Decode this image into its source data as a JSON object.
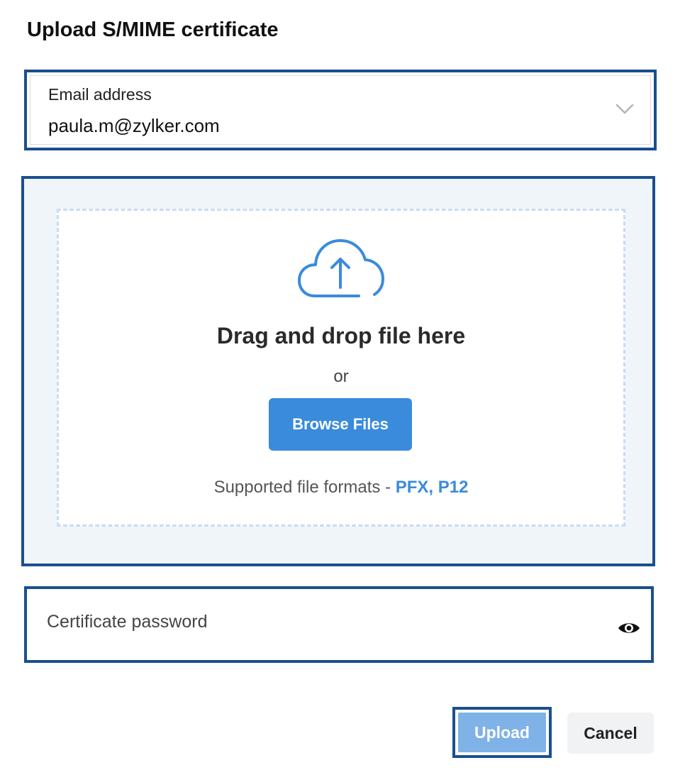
{
  "dialog": {
    "title": "Upload S/MIME certificate"
  },
  "email": {
    "label": "Email address",
    "value": "paula.m@zylker.com",
    "icon": "chevron-down-icon"
  },
  "dropzone": {
    "icon": "cloud-upload-icon",
    "title": "Drag and drop file here",
    "or_text": "or",
    "browse_label": "Browse Files",
    "formats_prefix": "Supported file formats - ",
    "formats_value": "PFX, P12"
  },
  "password": {
    "placeholder": "Certificate password",
    "value": "",
    "icon": "eye-icon"
  },
  "actions": {
    "upload_label": "Upload",
    "cancel_label": "Cancel"
  },
  "colors": {
    "focus_border": "#1b4f8f",
    "primary": "#3a8bdb",
    "primary_disabled": "#7fb2e6",
    "dropzone_bg": "#f0f5fa",
    "dashed_border": "#c9ddf1"
  }
}
